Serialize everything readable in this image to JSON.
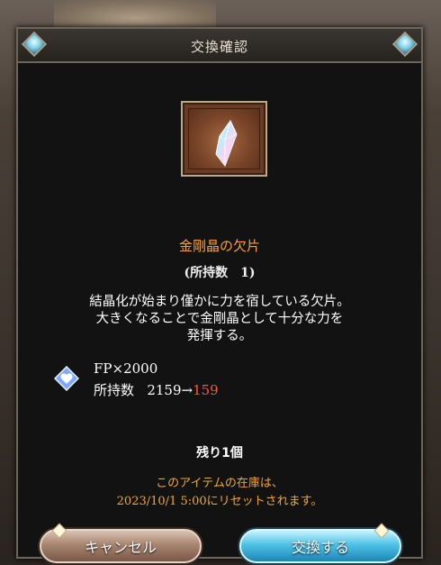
{
  "dialog": {
    "title": "交換確認"
  },
  "item": {
    "name": "金剛晶の欠片",
    "owned_label": "(所持数　1)",
    "description_lines": [
      "結晶化が始まり僅かに力を宿している欠片。",
      "大きくなることで金剛晶として十分な力を",
      "発揮する。"
    ],
    "icon": "crystal-shard-icon"
  },
  "cost": {
    "icon": "fp-heart-icon",
    "line1": "FP×2000",
    "owned_label": "所持数",
    "owned_before": "2159→",
    "owned_after": "159"
  },
  "remaining": "残り1個",
  "stock_notice": {
    "line1": "このアイテムの在庫は、",
    "line2": "2023/10/1 5:00にリセットされます。"
  },
  "buttons": {
    "cancel": "キャンセル",
    "confirm": "交換する"
  },
  "colors": {
    "item_name": "#f7a236",
    "cost_after": "#ff5a2c",
    "stock_notice": "#f0a730",
    "confirm_button": "#4fc2e6",
    "cancel_button": "#a88570"
  }
}
